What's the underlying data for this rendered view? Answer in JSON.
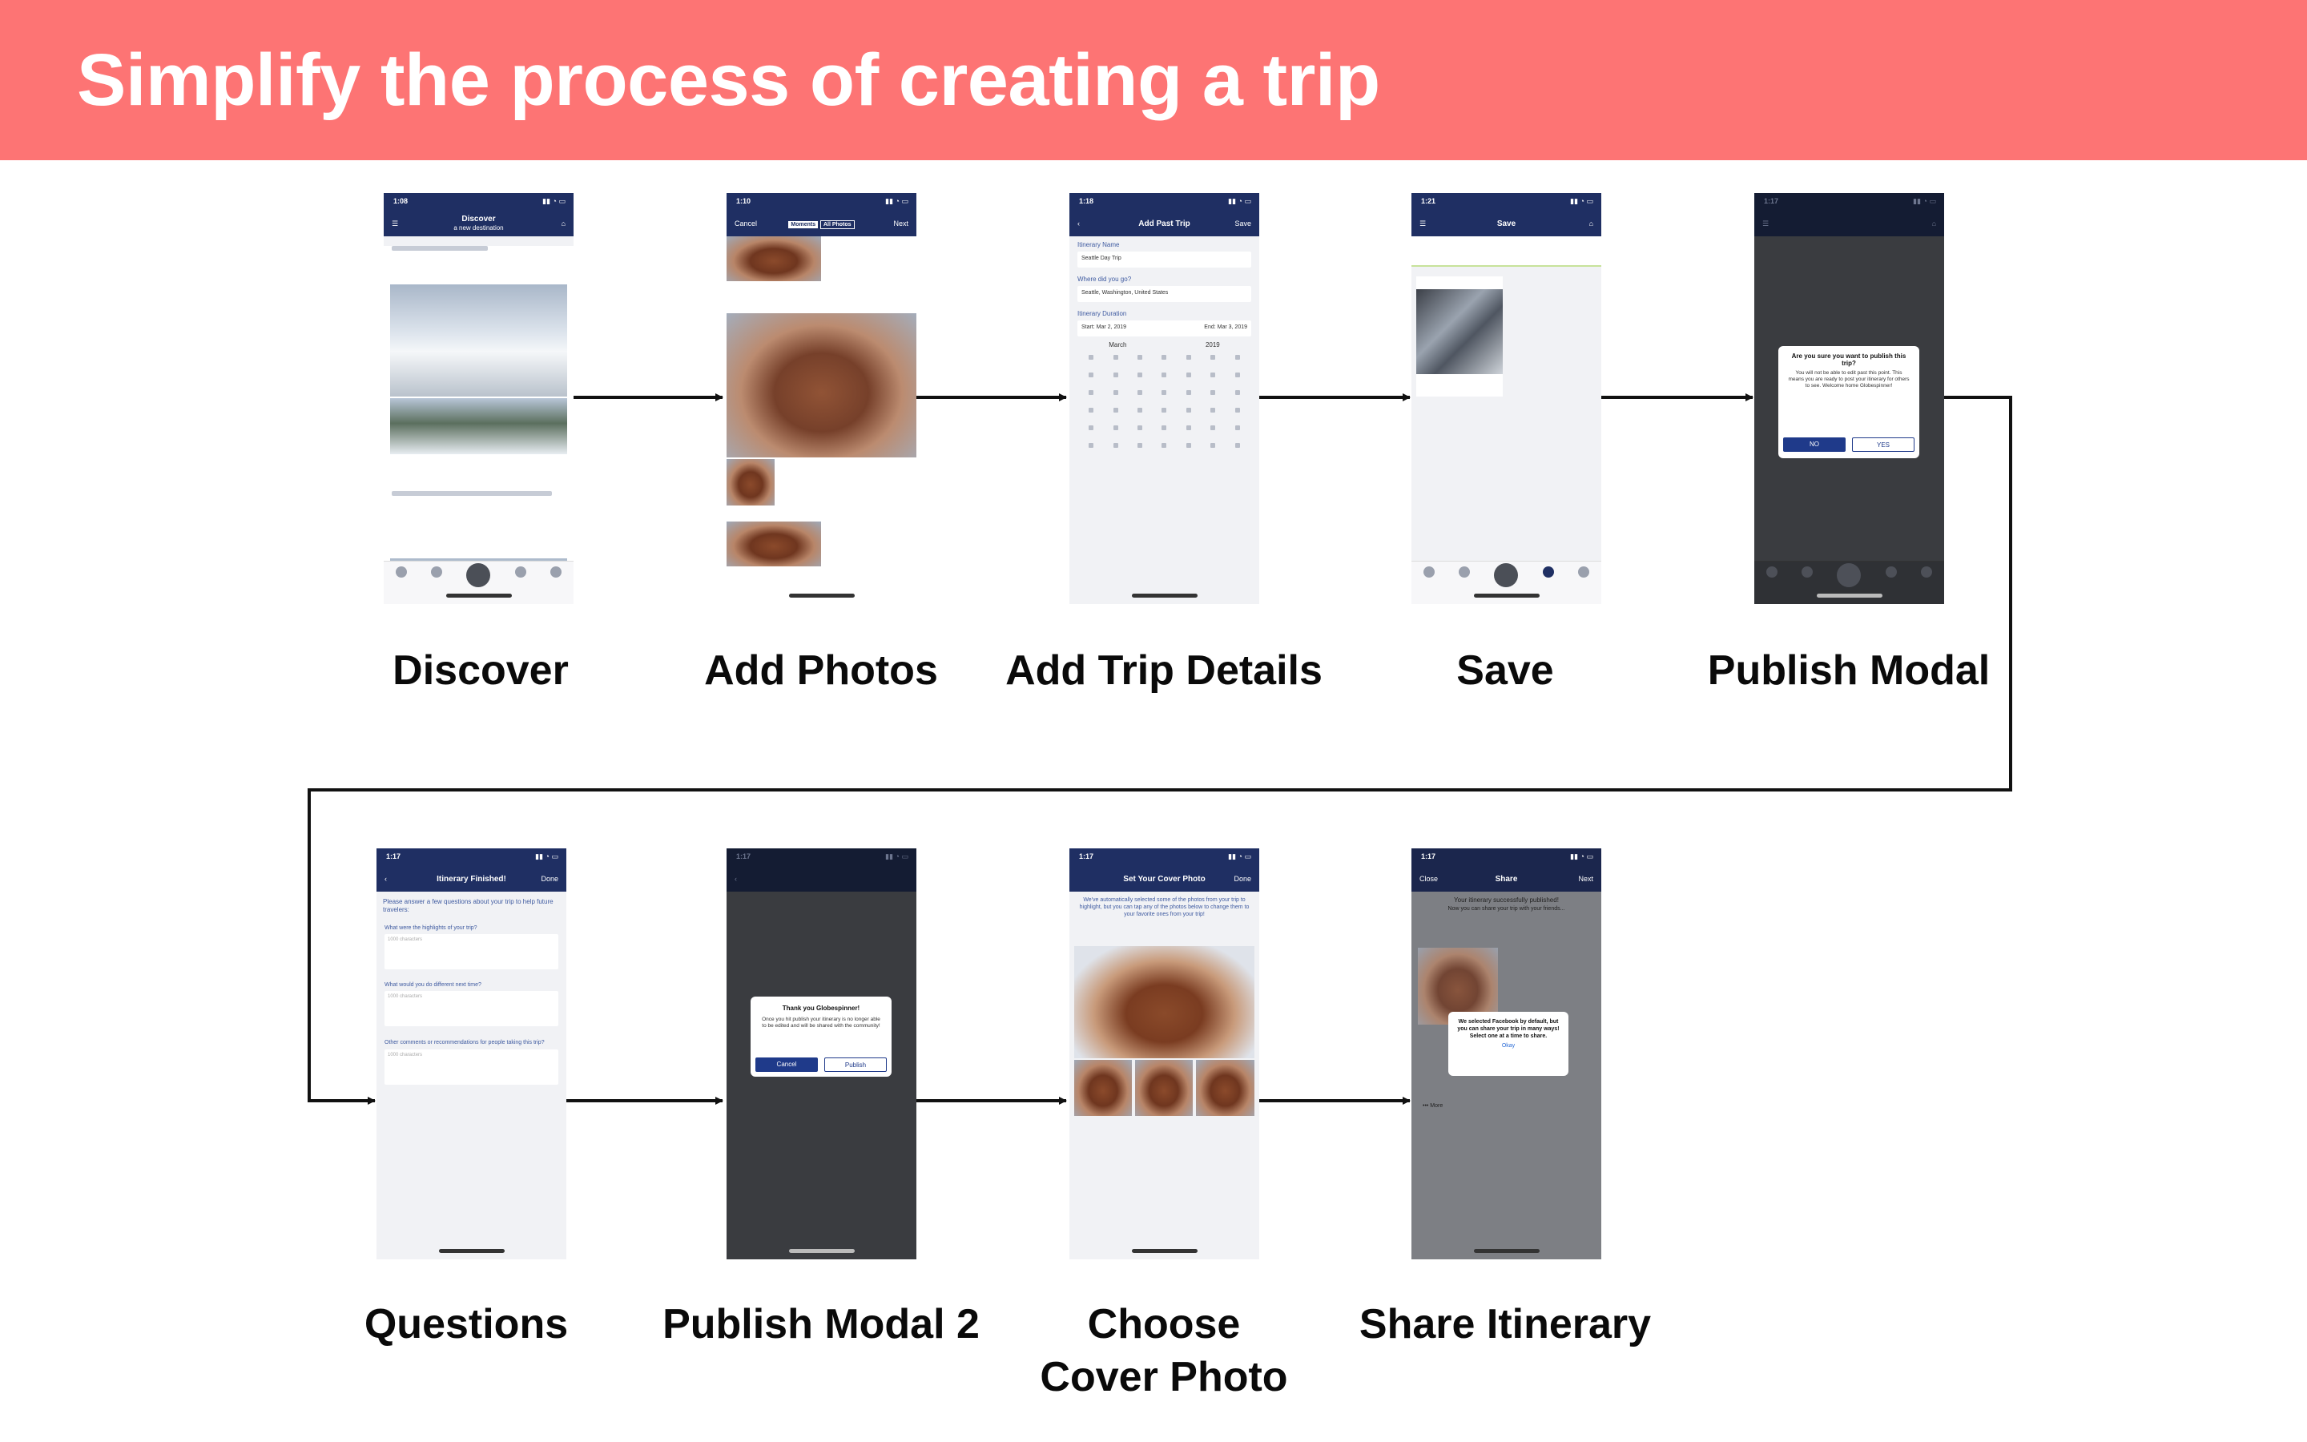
{
  "banner": {
    "title": "Simplify the process of creating a trip",
    "color": "#fd7474"
  },
  "steps": [
    {
      "label": "Discover"
    },
    {
      "label": "Add Photos"
    },
    {
      "label": "Add Trip Details"
    },
    {
      "label": "Save"
    },
    {
      "label": "Publish Modal"
    },
    {
      "label": "Questions"
    },
    {
      "label": "Publish Modal 2"
    },
    {
      "label": "Choose\nCover Photo"
    },
    {
      "label": "Share Itinerary"
    }
  ],
  "screens": {
    "discover": {
      "time": "1:08",
      "title": "Discover",
      "subtitle": "a new destination"
    },
    "add_photos": {
      "time": "1:10",
      "left": "Cancel",
      "right": "Next",
      "tab_a": "Moments",
      "tab_b": "All Photos"
    },
    "add_trip": {
      "time": "1:18",
      "title": "Add Past Trip",
      "right": "Save",
      "field1_label": "Itinerary Name",
      "field1_value": "Seattle Day Trip",
      "field2_label": "Where did you go?",
      "field2_value": "Seattle, Washington, United States",
      "duration_label": "Itinerary Duration",
      "start": "Start: Mar 2, 2019",
      "end": "End: Mar 3, 2019",
      "month": "March",
      "year": "2019"
    },
    "save": {
      "time": "1:21",
      "title": "Save"
    },
    "publish_modal": {
      "time": "1:17",
      "question": "Are you sure you want to publish this trip?",
      "body": "You will not be able to edit past this point. This means you are ready to post your itinerary for others to see. Welcome home Globespinner!",
      "no": "NO",
      "yes": "YES"
    },
    "questions": {
      "time": "1:17",
      "title": "Itinerary Finished!",
      "right": "Done",
      "intro": "Please answer a few questions about your trip to help future travelers:",
      "q1": "What were the highlights of your trip?",
      "q2": "What would you do different next time?",
      "q3": "Other comments or recommendations for people taking this trip?",
      "placeholder": "1000 characters"
    },
    "publish_modal_2": {
      "time": "1:17",
      "title": "Thank you Globespinner!",
      "body": "Once you hit publish your itinerary is no longer able to be edited and will be shared with the community!",
      "cancel": "Cancel",
      "publish": "Publish"
    },
    "cover_photo": {
      "time": "1:17",
      "title": "Set Your Cover Photo",
      "right": "Done",
      "body": "We've automatically selected some of the photos from your trip to highlight, but you can tap any of the photos below to change them to your favorite ones from your trip!"
    },
    "share": {
      "time": "1:17",
      "left": "Close",
      "title": "Share",
      "right": "Next",
      "headline": "Your itinerary successfully published!",
      "sub": "Now you can share your trip with your friends...",
      "modal": "We selected Facebook by default, but you can share your trip in many ways! Select one at a time to share.",
      "okay": "Okay",
      "more": "More"
    }
  },
  "colors": {
    "nav": "#1f2f63",
    "arrow": "#111111"
  }
}
